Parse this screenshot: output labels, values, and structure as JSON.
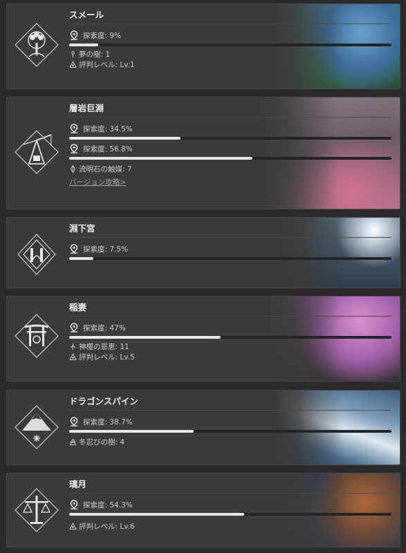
{
  "regions": [
    {
      "name": "スメール",
      "emblem": "tree-emblem-icon",
      "progress": [
        {
          "label": "探索度: 9%",
          "value": 9
        }
      ],
      "stats": [
        {
          "icon": "dream-tree-icon",
          "text": "夢の樹: 1"
        },
        {
          "icon": "reputation-icon",
          "text": "評判レベル: Lv.1"
        }
      ],
      "link": null,
      "colors": [
        "#5a8fbf",
        "#3f7a4f",
        "#2d5a3a"
      ]
    },
    {
      "name": "層岩巨淵",
      "emblem": "crane-emblem-icon",
      "progress": [
        {
          "label": "探索度: 34.5%",
          "value": 34.5
        },
        {
          "label": "探索度: 56.8%",
          "value": 56.8
        }
      ],
      "stats": [
        {
          "icon": "lumenstone-icon",
          "text": "流明石の触媒: 7"
        }
      ],
      "link": "バージョン攻略>",
      "colors": [
        "#7a6f78",
        "#9c7a8a",
        "#c07090"
      ]
    },
    {
      "name": "淵下宮",
      "emblem": "enkanomiya-emblem-icon",
      "progress": [
        {
          "label": "探索度: 7.5%",
          "value": 7.5
        }
      ],
      "stats": [],
      "link": null,
      "colors": [
        "#3a4a58",
        "#6c8090",
        "#c8d2dc"
      ]
    },
    {
      "name": "稲妻",
      "emblem": "torii-emblem-icon",
      "progress": [
        {
          "label": "探索度: 47%",
          "value": 47
        }
      ],
      "stats": [
        {
          "icon": "sacred-sakura-icon",
          "text": "神櫻の恩恵: 11"
        },
        {
          "icon": "reputation-icon",
          "text": "評判レベル: Lv.5"
        }
      ],
      "link": null,
      "colors": [
        "#c47bc0",
        "#8a5a9a",
        "#4a3a48"
      ]
    },
    {
      "name": "ドラゴンスパイン",
      "emblem": "mountain-emblem-icon",
      "progress": [
        {
          "label": "探索度: 38.7%",
          "value": 38.7
        }
      ],
      "stats": [
        {
          "icon": "frostbearing-tree-icon",
          "text": "冬忍びの樹: 4"
        }
      ],
      "link": null,
      "colors": [
        "#4a6a8a",
        "#c8d8e8",
        "#2f4c6a"
      ]
    },
    {
      "name": "璃月",
      "emblem": "scales-emblem-icon",
      "progress": [
        {
          "label": "探索度: 54.3%",
          "value": 54.3
        }
      ],
      "stats": [
        {
          "icon": "reputation-icon",
          "text": "評判レベル: Lv.6"
        }
      ],
      "link": null,
      "colors": [
        "#3a4a6a",
        "#8a5a3a",
        "#d08a4a"
      ]
    }
  ]
}
